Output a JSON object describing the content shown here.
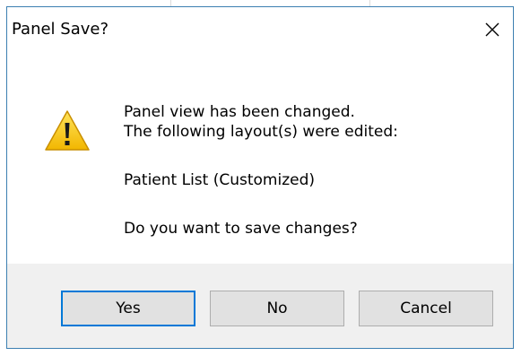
{
  "dialog": {
    "title": "Panel Save?",
    "icon": "warning-icon",
    "message": {
      "line1": "Panel view has been changed.",
      "line2": "The following layout(s) were edited:",
      "layout_name": "Patient List (Customized)",
      "question": "Do you want to save changes?"
    },
    "buttons": {
      "yes": "Yes",
      "no": "No",
      "cancel": "Cancel"
    }
  },
  "colors": {
    "border_accent": "#3c7fb1",
    "default_button_border": "#0078d7",
    "footer_bg": "#f0f0f0",
    "warning_yellow": "#f5c400"
  }
}
